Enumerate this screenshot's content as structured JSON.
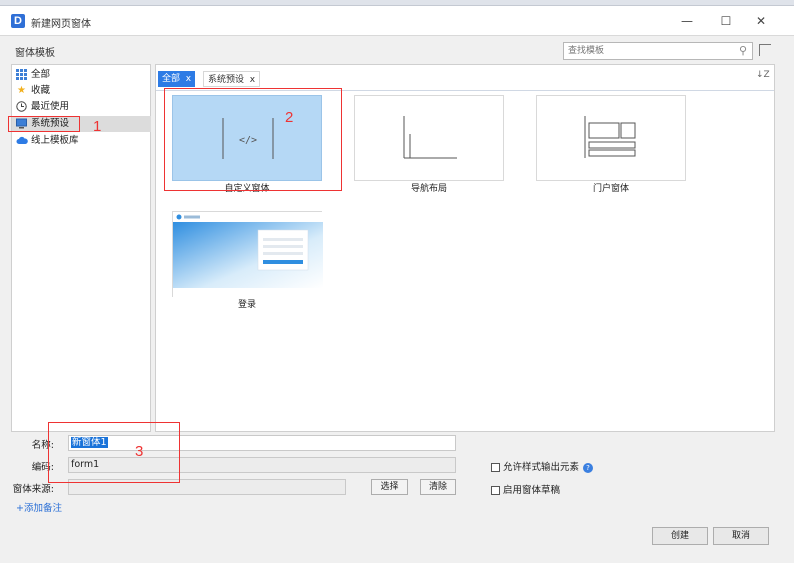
{
  "window": {
    "title": "新建网页窗体"
  },
  "templates_label": "窗体模板",
  "search": {
    "placeholder": "查找模板"
  },
  "sidebar": {
    "items": [
      {
        "label": "全部",
        "icon": "grid-icon"
      },
      {
        "label": "收藏",
        "icon": "star-icon"
      },
      {
        "label": "最近使用",
        "icon": "clock-icon"
      },
      {
        "label": "系统预设",
        "icon": "monitor-icon",
        "active": true
      },
      {
        "label": "线上模板库",
        "icon": "cloud-icon"
      }
    ]
  },
  "tabs": {
    "all": "全部",
    "filter": "系统预设"
  },
  "templates": [
    {
      "label": "自定义窗体"
    },
    {
      "label": "导航布局"
    },
    {
      "label": "门户窗体"
    },
    {
      "label": "登录"
    }
  ],
  "form": {
    "name_label": "名称:",
    "name_value": "新窗体1",
    "code_label": "编码:",
    "code_value": "form1",
    "source_label": "窗体来源:",
    "choose_button": "选择",
    "clear_button": "清除",
    "add_remark": "+添加备注",
    "allow_style_label": "允许样式输出元素",
    "enable_draft_label": "启用窗体草稿"
  },
  "buttons": {
    "create": "创建",
    "cancel": "取消"
  },
  "annotations": [
    "1",
    "2",
    "3"
  ],
  "colors": {
    "accent": "#2d7be5",
    "selected_card": "#b5d8f5",
    "annotation": "#ee3333"
  }
}
